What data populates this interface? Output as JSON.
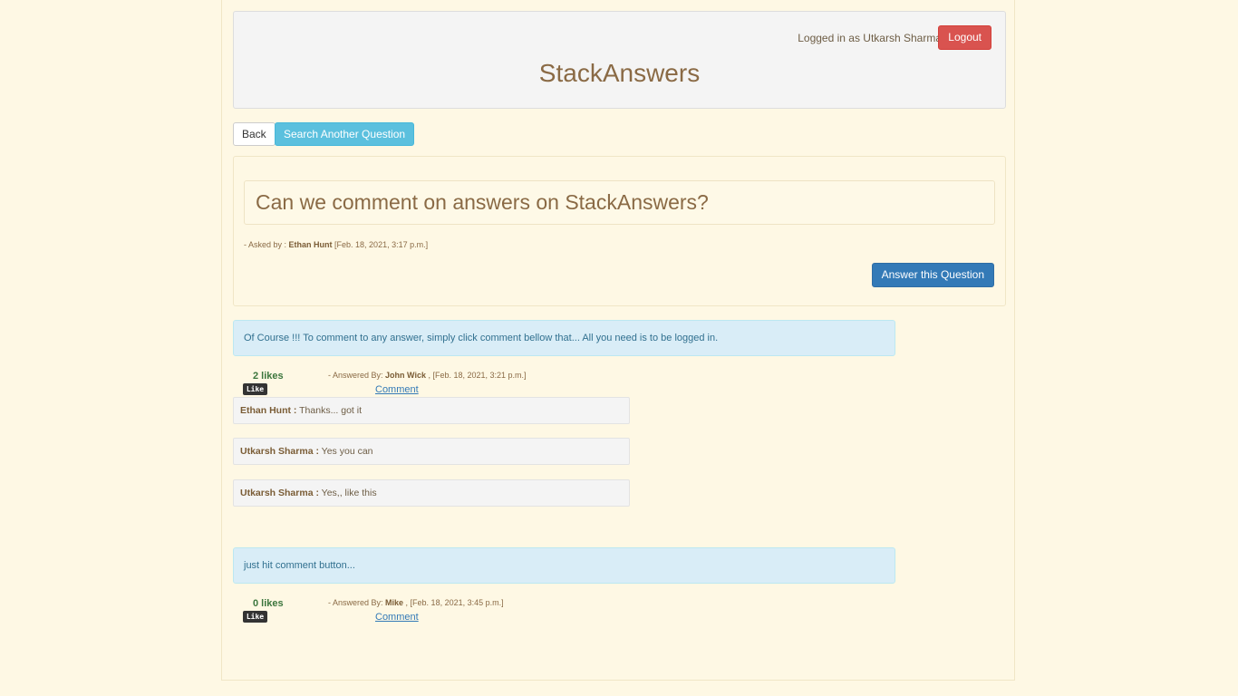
{
  "header": {
    "login_text": "Logged in as Utkarsh Sharma",
    "logout_label": "Logout",
    "site_title": "StackAnswers"
  },
  "nav": {
    "back_label": "Back",
    "search_label": "Search Another Question"
  },
  "question": {
    "title": "Can we comment on answers on StackAnswers?",
    "asked_prefix": "- Asked by : ",
    "author": "Ethan Hunt",
    "date": " [Feb. 18, 2021, 3:17 p.m.]",
    "answer_button": "Answer this Question"
  },
  "answers": [
    {
      "text": "Of Course !!! To comment to any answer, simply click comment bellow that... All you need is to be logged in.",
      "likes": "2 likes",
      "like_label": "Like",
      "answered_prefix": "- Answered By: ",
      "author": "John Wick",
      "date": " , [Feb. 18, 2021, 3:21 p.m.]",
      "comment_label": "Comment",
      "comments": [
        {
          "author": "Ethan Hunt :",
          "text": " Thanks... got it"
        },
        {
          "author": "Utkarsh Sharma :",
          "text": " Yes you can"
        },
        {
          "author": "Utkarsh Sharma :",
          "text": " Yes,, like this"
        }
      ]
    },
    {
      "text": "just hit comment button...",
      "likes": "0 likes",
      "like_label": "Like",
      "answered_prefix": "- Answered By: ",
      "author": "Mike",
      "date": " , [Feb. 18, 2021, 3:45 p.m.]",
      "comment_label": "Comment",
      "comments": []
    }
  ]
}
